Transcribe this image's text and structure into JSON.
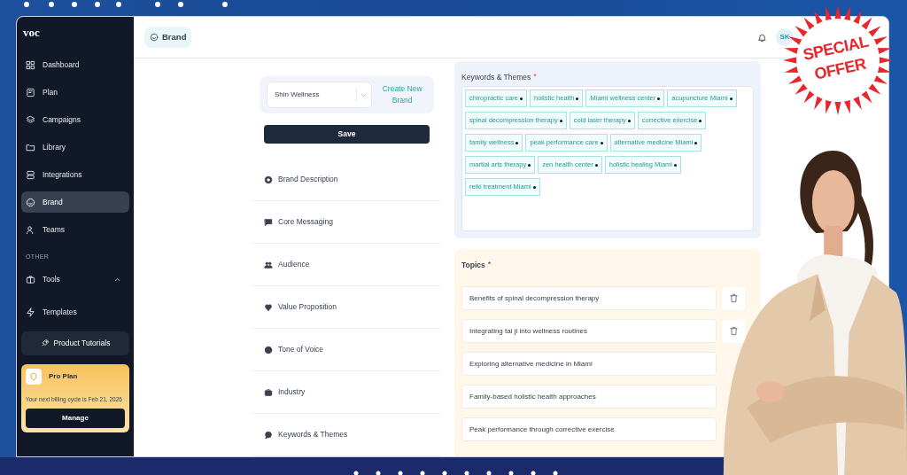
{
  "sidebar": {
    "logo": "voc",
    "items": [
      {
        "label": "Dashboard",
        "selected": false
      },
      {
        "label": "Plan",
        "selected": false
      },
      {
        "label": "Campaigns",
        "selected": false
      },
      {
        "label": "Library",
        "selected": false
      },
      {
        "label": "Integrations",
        "selected": false
      },
      {
        "label": "Brand",
        "selected": true
      },
      {
        "label": "Teams",
        "selected": false
      }
    ],
    "other": {
      "heading": "OTHER",
      "items": [
        {
          "label": "Tools",
          "expanded": true
        },
        {
          "label": "Templates"
        }
      ]
    },
    "tutorials_button": "Product Tutorials",
    "plan_card": {
      "title": "Pro Plan",
      "note": "Your next billing cycle is Feb 21, 2026",
      "button": "Manage"
    }
  },
  "header": {
    "breadcrumb": "Brand",
    "avatar": "SK"
  },
  "brand_selector": {
    "value": "Shin Wellness",
    "link": "Create New Brand"
  },
  "save_button": "Save",
  "sections": [
    "Brand Description",
    "Core Messaging",
    "Audience",
    "Value Proposition",
    "Tone of Voice",
    "Industry",
    "Keywords & Themes"
  ],
  "keywords": {
    "label": "Keywords & Themes",
    "required_mark": "*",
    "tags": [
      "chiropractic care",
      "holistic health",
      "Miami wellness center",
      "acupuncture Miami",
      "spinal decompression therapy",
      "cold laser therapy",
      "corrective exercise",
      "family wellness",
      "peak performance care",
      "alternative medicine Miami",
      "martial arts therapy",
      "zen health center",
      "holistic healing Miami",
      "reiki treatment Miami"
    ]
  },
  "topics": {
    "label": "Topics",
    "required_mark": "*",
    "items": [
      "Benefits of spinal decompression therapy",
      "Integrating tai ji into wellness routines",
      "Exploring alternative medicine in Miami",
      "Family-based holistic health approaches",
      "Peak performance through corrective exercise"
    ]
  },
  "promo": {
    "lines": [
      "SPECIAL",
      "OFFER"
    ]
  }
}
